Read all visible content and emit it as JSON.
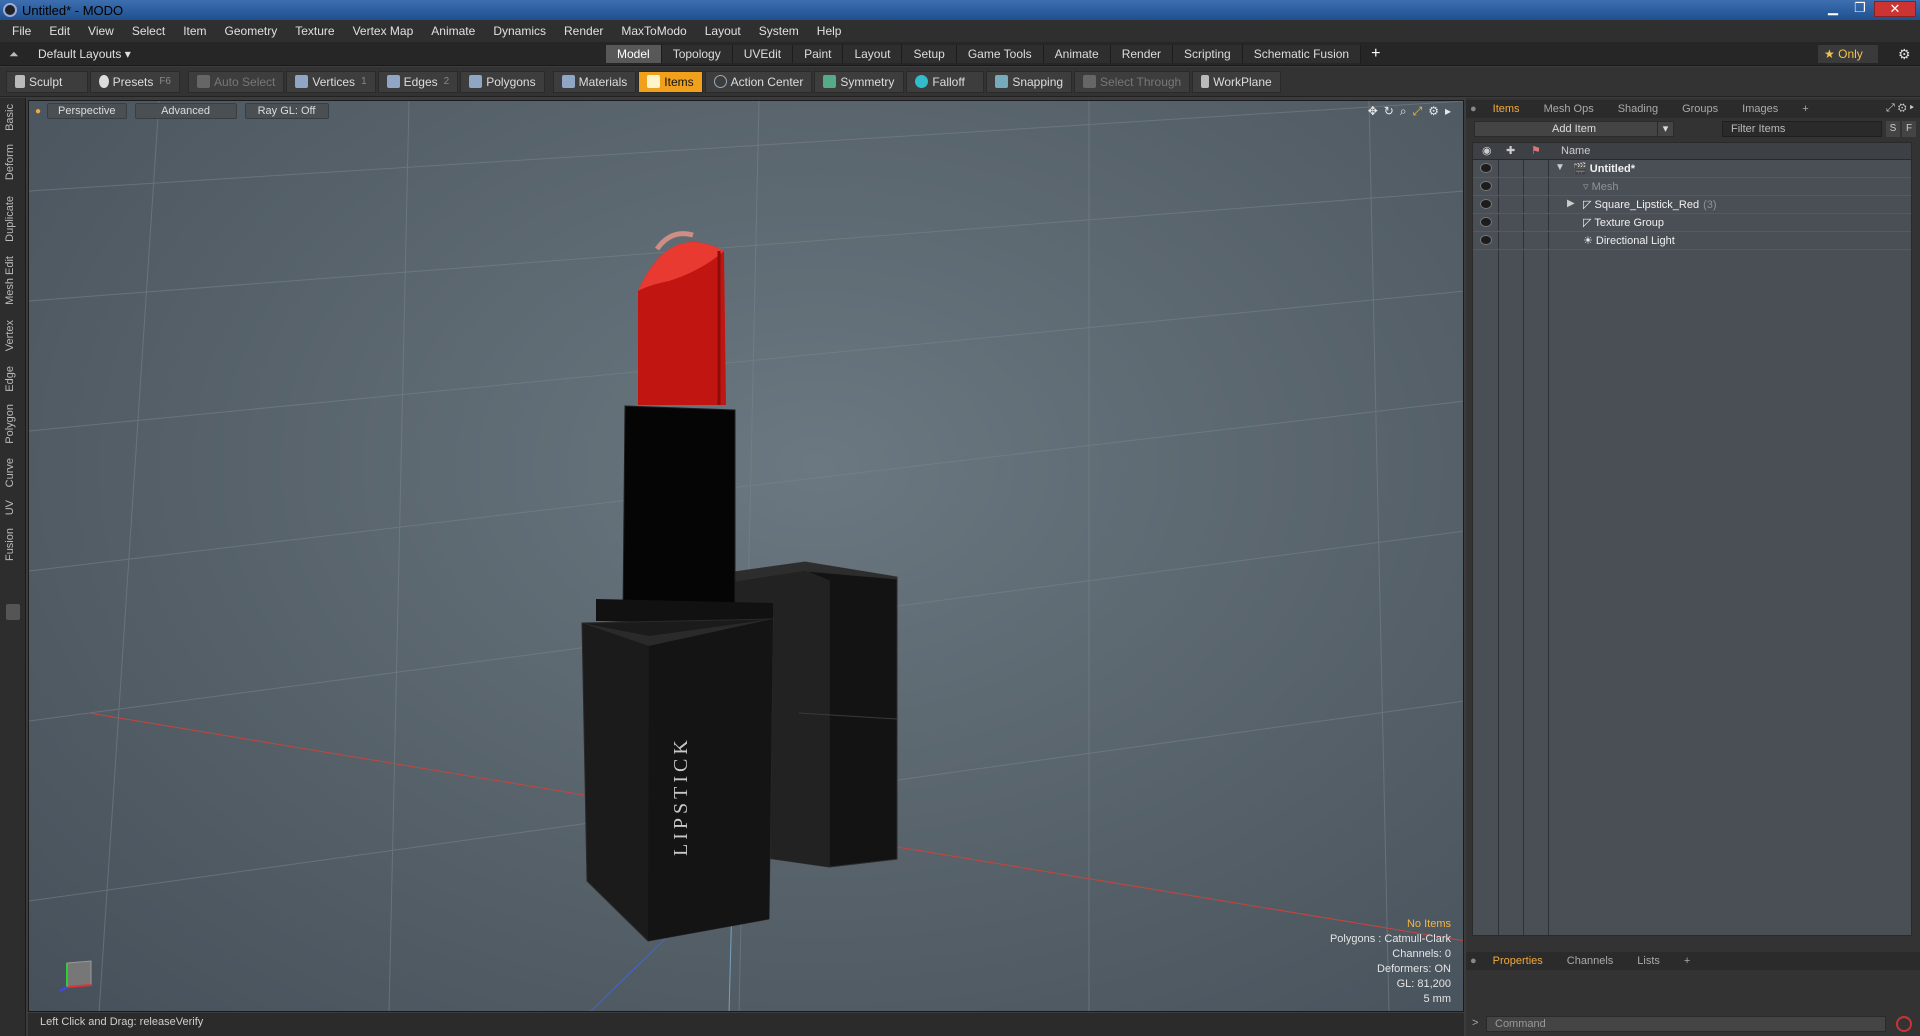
{
  "window": {
    "title": "Untitled* - MODO"
  },
  "menu": [
    "File",
    "Edit",
    "View",
    "Select",
    "Item",
    "Geometry",
    "Texture",
    "Vertex Map",
    "Animate",
    "Dynamics",
    "Render",
    "MaxToModo",
    "Layout",
    "System",
    "Help"
  ],
  "layout": {
    "default_layouts": "Default Layouts ▾",
    "tabs": [
      "Model",
      "Topology",
      "UVEdit",
      "Paint",
      "Layout",
      "Setup",
      "Game Tools",
      "Animate",
      "Render",
      "Scripting",
      "Schematic Fusion"
    ],
    "active_tab": "Model",
    "only_label": "Only"
  },
  "toolbar": {
    "sculpt": "Sculpt",
    "presets": "Presets",
    "presets_key": "F6",
    "auto_select": "Auto Select",
    "vertices": "Vertices",
    "vertices_key": "1",
    "edges": "Edges",
    "edges_key": "2",
    "polygons": "Polygons",
    "materials": "Materials",
    "items": "Items",
    "action_center": "Action Center",
    "symmetry": "Symmetry",
    "falloff": "Falloff",
    "snapping": "Snapping",
    "select_through": "Select Through",
    "workplane": "WorkPlane"
  },
  "left_tabs": [
    "Basic",
    "Deform",
    "Duplicate",
    "Mesh Edit",
    "Vertex",
    "Edge",
    "Polygon",
    "Curve",
    "UV",
    "Fusion"
  ],
  "viewport": {
    "perspective": "Perspective",
    "advanced": "Advanced",
    "raygl": "Ray GL: Off",
    "lipstick_text": "LIPSTICK",
    "hud": {
      "no_items": "No Items",
      "polygons": "Polygons : Catmull-Clark",
      "channels": "Channels: 0",
      "deformers": "Deformers: ON",
      "gl": "GL: 81,200",
      "scale": "5 mm"
    }
  },
  "status": {
    "text": "Left Click and Drag:   releaseVerify"
  },
  "items_panel": {
    "tabs": [
      "Items",
      "Mesh Ops",
      "Shading",
      "Groups",
      "Images"
    ],
    "add_item": "Add Item",
    "filter_placeholder": "Filter Items",
    "s_btn": "S",
    "f_btn": "F",
    "column_name": "Name",
    "rows": [
      {
        "label": "Untitled*"
      },
      {
        "label": "Mesh"
      },
      {
        "label": "Square_Lipstick_Red",
        "count": "(3)"
      },
      {
        "label": "Texture Group"
      },
      {
        "label": "Directional Light"
      }
    ]
  },
  "properties_panel": {
    "tabs": [
      "Properties",
      "Channels",
      "Lists"
    ],
    "command_placeholder": "Command"
  }
}
